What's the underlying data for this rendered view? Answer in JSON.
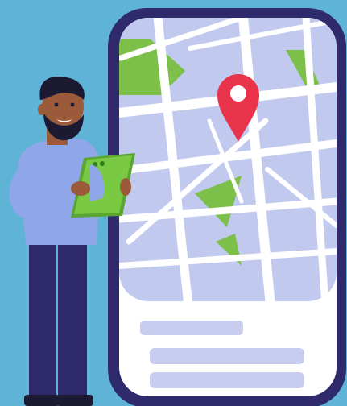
{
  "colors": {
    "background": "#5fb3d6",
    "phone_frame": "#2e2a6b",
    "map_base": "#c2c9ef",
    "map_roads": "#ffffff",
    "parks": "#7cc04a",
    "pin": "#e8334a",
    "panel": "#ffffff",
    "panel_bars": "#c8cdef",
    "shirt": "#8fa6e8",
    "pants": "#2e2a6b",
    "skin": "#9b5a3a",
    "hair": "#1c1a33",
    "tablet": "#7ac943"
  },
  "icons": {
    "location_pin": "map-pin-icon"
  }
}
